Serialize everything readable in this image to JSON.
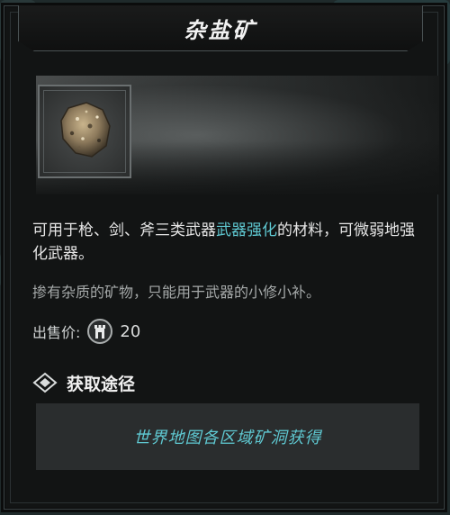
{
  "item": {
    "name": "杂盐矿",
    "description_part1": "可用于枪、剑、斧三类武器",
    "description_highlight": "武器强化",
    "description_part2": "的材料，可微弱地强化武器。",
    "flavor": "掺有杂质的矿物，只能用于武器的小修小补。",
    "price_label": "出售价:",
    "price_value": "20",
    "icon": "ore-chunk-icon",
    "currency_icon": "tower-coin-icon"
  },
  "source": {
    "title": "获取途径",
    "icon": "diamond-icon",
    "entries": [
      "世界地图各区域矿洞获得"
    ]
  },
  "colors": {
    "highlight": "#5fc9d2",
    "panel_bg": "#121414",
    "source_box_bg": "#2a2d2e"
  }
}
